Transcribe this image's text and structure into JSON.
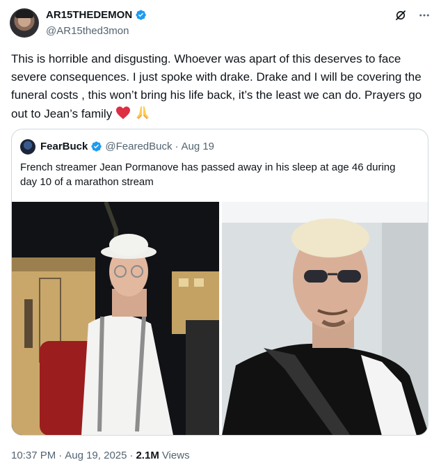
{
  "author": {
    "display_name": "AR15THEDEMON",
    "handle": "@AR15thed3mon",
    "verified": true,
    "avatar_icon": "user-avatar"
  },
  "actions": {
    "grok_icon": "grok-icon",
    "more_icon": "more-options-icon"
  },
  "tweet": {
    "text": "This is horrible and disgusting. Whoever was apart of this deserves to face severe consequences. I just spoke with drake. Drake and I will be covering the funeral costs , this won’t bring his life back, it’s the least we can do. Prayers go out to Jean’s family",
    "emojis": [
      "red-heart",
      "folded-hands"
    ]
  },
  "quote": {
    "display_name": "FearBuck",
    "handle": "@FearedBuck",
    "separator": "·",
    "date": "Aug 19",
    "verified": true,
    "text": "French streamer Jean Pormanove has passed away in his sleep at age 46 during day 10 of a marathon stream",
    "images": [
      "man-in-white-cap-at-night",
      "man-with-sunglasses-selfie"
    ]
  },
  "footer": {
    "time": "10:37 PM",
    "separator": "·",
    "date": "Aug 19, 2025",
    "separator2": "·",
    "views_count": "2.1M",
    "views_label": "Views"
  },
  "colors": {
    "text": "#0f1419",
    "secondary": "#536471",
    "verified": "#1d9bf0",
    "border": "#cfd9de"
  }
}
